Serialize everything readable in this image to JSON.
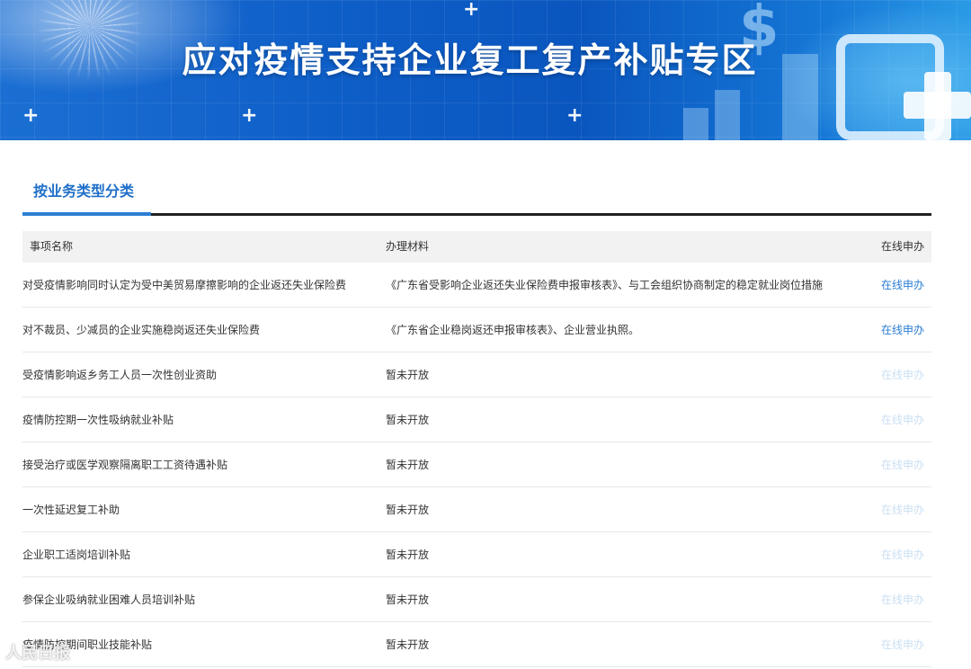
{
  "banner": {
    "title": "应对疫情支持企业复工复产补贴专区"
  },
  "tabs": [
    {
      "label": "按业务类型分类",
      "active": true
    }
  ],
  "table": {
    "headers": [
      "事项名称",
      "办理材料",
      "在线申办"
    ],
    "rows": [
      {
        "name": "对受疫情影响同时认定为受中美贸易摩擦影响的企业返还失业保险费",
        "materials": "《广东省受影响企业返还失业保险费申报审核表》、与工会组织协商制定的稳定就业岗位措施",
        "action": "在线申办",
        "enabled": true
      },
      {
        "name": "对不裁员、少减员的企业实施稳岗返还失业保险费",
        "materials": "《广东省企业稳岗返还申报审核表》、企业营业执照。",
        "action": "在线申办",
        "enabled": true
      },
      {
        "name": "受疫情影响返乡务工人员一次性创业资助",
        "materials": "暂未开放",
        "action": "在线申办",
        "enabled": false
      },
      {
        "name": "疫情防控期一次性吸纳就业补贴",
        "materials": "暂未开放",
        "action": "在线申办",
        "enabled": false
      },
      {
        "name": "接受治疗或医学观察隔离职工工资待遇补贴",
        "materials": "暂未开放",
        "action": "在线申办",
        "enabled": false
      },
      {
        "name": "一次性延迟复工补助",
        "materials": "暂未开放",
        "action": "在线申办",
        "enabled": false
      },
      {
        "name": "企业职工适岗培训补贴",
        "materials": "暂未开放",
        "action": "在线申办",
        "enabled": false
      },
      {
        "name": "参保企业吸纳就业困难人员培训补贴",
        "materials": "暂未开放",
        "action": "在线申办",
        "enabled": false
      },
      {
        "name": "疫情防控期间职业技能补贴",
        "materials": "暂未开放",
        "action": "在线申办",
        "enabled": false
      }
    ]
  },
  "watermark": "人民日报",
  "colors": {
    "accent": "#2a7dd3",
    "disabled": "#c9dff3",
    "banner": "#0e5ec8"
  }
}
